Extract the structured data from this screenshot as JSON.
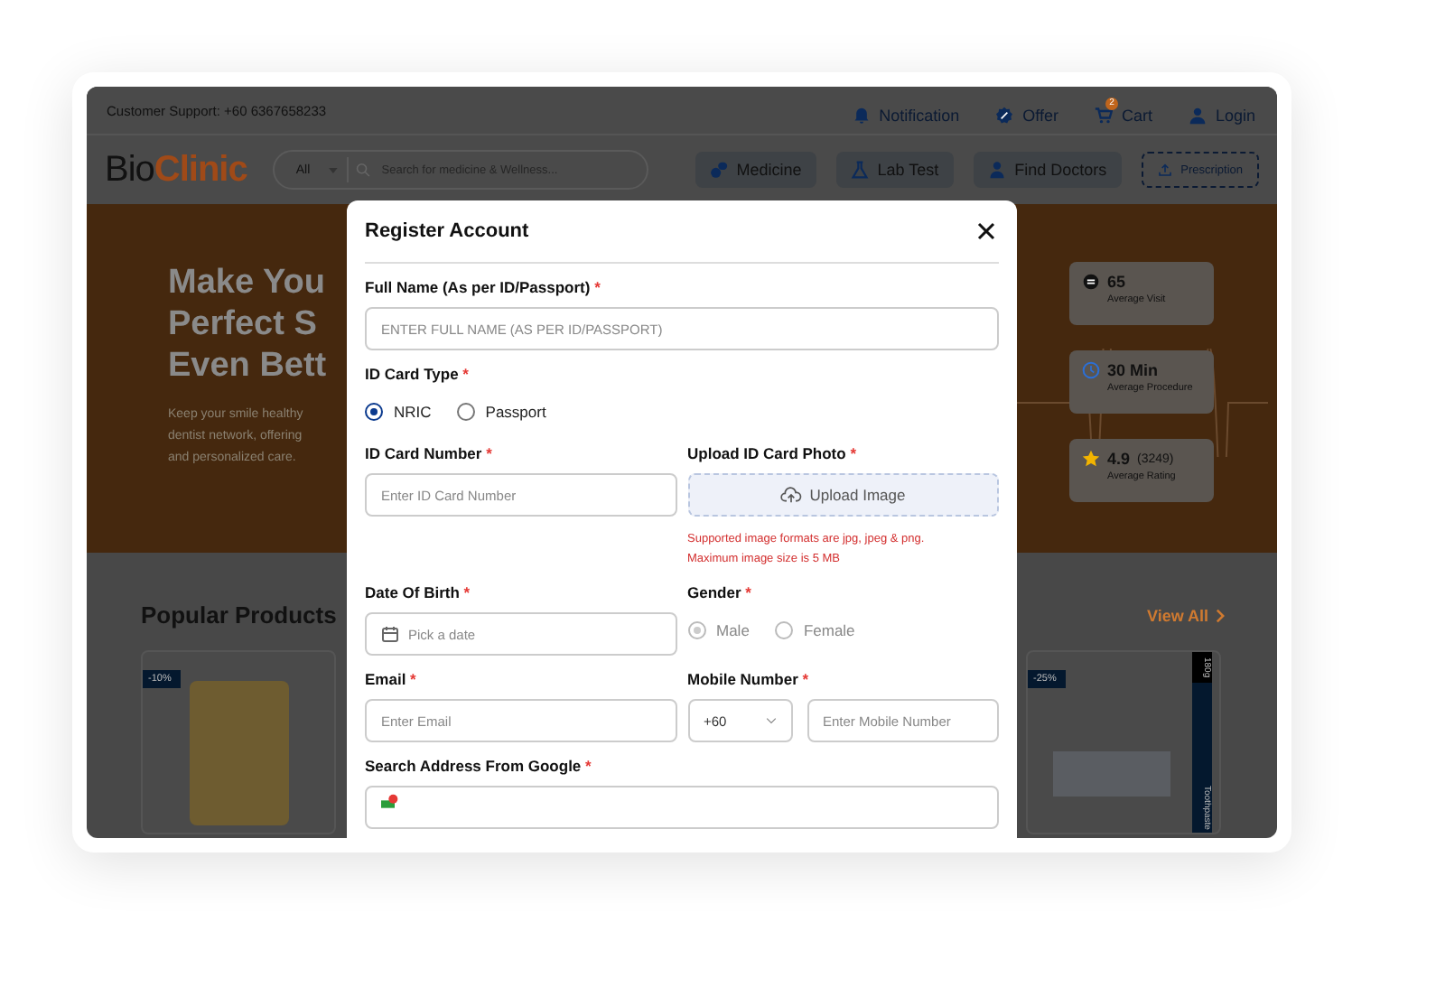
{
  "top_bar": {
    "support": "Customer Support: +60 6367658233",
    "links": [
      {
        "label": "Notification"
      },
      {
        "label": "Offer"
      },
      {
        "label": "Cart",
        "badge": "2"
      },
      {
        "label": "Login"
      }
    ]
  },
  "header": {
    "logo": [
      "Bio",
      "Clinic"
    ],
    "search": {
      "category": "All",
      "placeholder": "Search for medicine & Wellness..."
    },
    "nav": [
      {
        "label": "Medicine",
        "kind": "solid"
      },
      {
        "label": "Lab Test",
        "kind": "solid"
      },
      {
        "label": "Find Doctors",
        "kind": "solid"
      },
      {
        "label": "Prescription",
        "kind": "dashed"
      }
    ]
  },
  "hero": {
    "title": [
      "Make You",
      "Perfect S",
      "Even Bett"
    ],
    "text": [
      "Keep your smile healthy",
      "dentist network, offering",
      "and personalized care."
    ],
    "stats": [
      {
        "value": "65",
        "label": "Average Visit"
      },
      {
        "value": "30 Min",
        "label": "Average Procedure"
      },
      {
        "value": "4.9",
        "extra": "(3249)",
        "label": "Average Rating"
      }
    ]
  },
  "products": {
    "title": "Popular Products",
    "view_all": "View All",
    "items": [
      {
        "discount": "-10%"
      },
      {
        "discount": "-25%",
        "size": "180g",
        "category": "Toothpaste"
      }
    ]
  },
  "modal": {
    "title": "Register Account",
    "rows": [
      {
        "fields": [
          {
            "kind": "text",
            "label": "Full Name (As per ID/Passport)",
            "required": "*",
            "placeholder": "ENTER FULL NAME (AS PER ID/PASSPORT)"
          }
        ]
      },
      {
        "fields": [
          {
            "kind": "radio",
            "label": "ID Card Type",
            "required": "*",
            "disabled": false,
            "options": [
              {
                "label": "NRIC",
                "selected": true
              },
              {
                "label": "Passport",
                "selected": false
              }
            ]
          }
        ]
      },
      {
        "fields": [
          {
            "kind": "text",
            "label": "ID Card Number",
            "required": "*",
            "placeholder": "Enter ID Card Number"
          },
          {
            "kind": "upload",
            "label": "Upload ID Card Photo",
            "required": "*",
            "button": "Upload Image",
            "notes": [
              "Supported image formats are jpg, jpeg & png.",
              "Maximum image size is 5 MB"
            ]
          }
        ]
      },
      {
        "fields": [
          {
            "kind": "date",
            "label": "Date Of Birth",
            "required": "*",
            "placeholder": "Pick a date"
          },
          {
            "kind": "radio",
            "label": "Gender",
            "required": "*",
            "disabled": true,
            "options": [
              {
                "label": "Male",
                "selected": true
              },
              {
                "label": "Female",
                "selected": false
              }
            ]
          }
        ]
      },
      {
        "fields": [
          {
            "kind": "text",
            "label": "Email",
            "required": "*",
            "placeholder": "Enter Email"
          },
          {
            "kind": "phone",
            "label": "Mobile Number",
            "required": "*",
            "code": "+60",
            "placeholder": "Enter Mobile Number"
          }
        ]
      },
      {
        "fields": [
          {
            "kind": "address",
            "label": "Search Address From Google",
            "required": "*"
          }
        ]
      }
    ]
  }
}
